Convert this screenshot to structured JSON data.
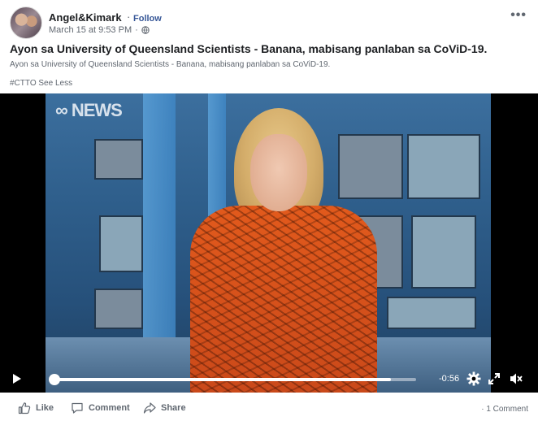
{
  "post": {
    "author": "Angel&Kimark",
    "separator": "·",
    "follow_label": "Follow",
    "timestamp": "March 15 at 9:53 PM",
    "meta_separator": "·",
    "title": "Ayon sa University of Queensland Scientists - Banana, mabisang panlaban sa CoViD-19.",
    "description": "Ayon sa University of Queensland Scientists - Banana, mabisang panlaban sa CoViD-19.",
    "hashtag": "#CTTO",
    "see_less_label": "See Less",
    "more_icon": "ellipsis-icon"
  },
  "video": {
    "channel_logo": "NEWS",
    "time_remaining": "-0:56",
    "progress": 0.01,
    "buffered": 0.93,
    "icons": [
      "play-icon",
      "gear-icon",
      "fullscreen-icon",
      "mute-icon"
    ]
  },
  "actions": {
    "like_label": "Like",
    "comment_label": "Comment",
    "share_label": "Share",
    "comment_count": "1 Comment"
  },
  "colors": {
    "link": "#385898",
    "secondary_text": "#606770",
    "primary_text": "#1c1e21"
  }
}
